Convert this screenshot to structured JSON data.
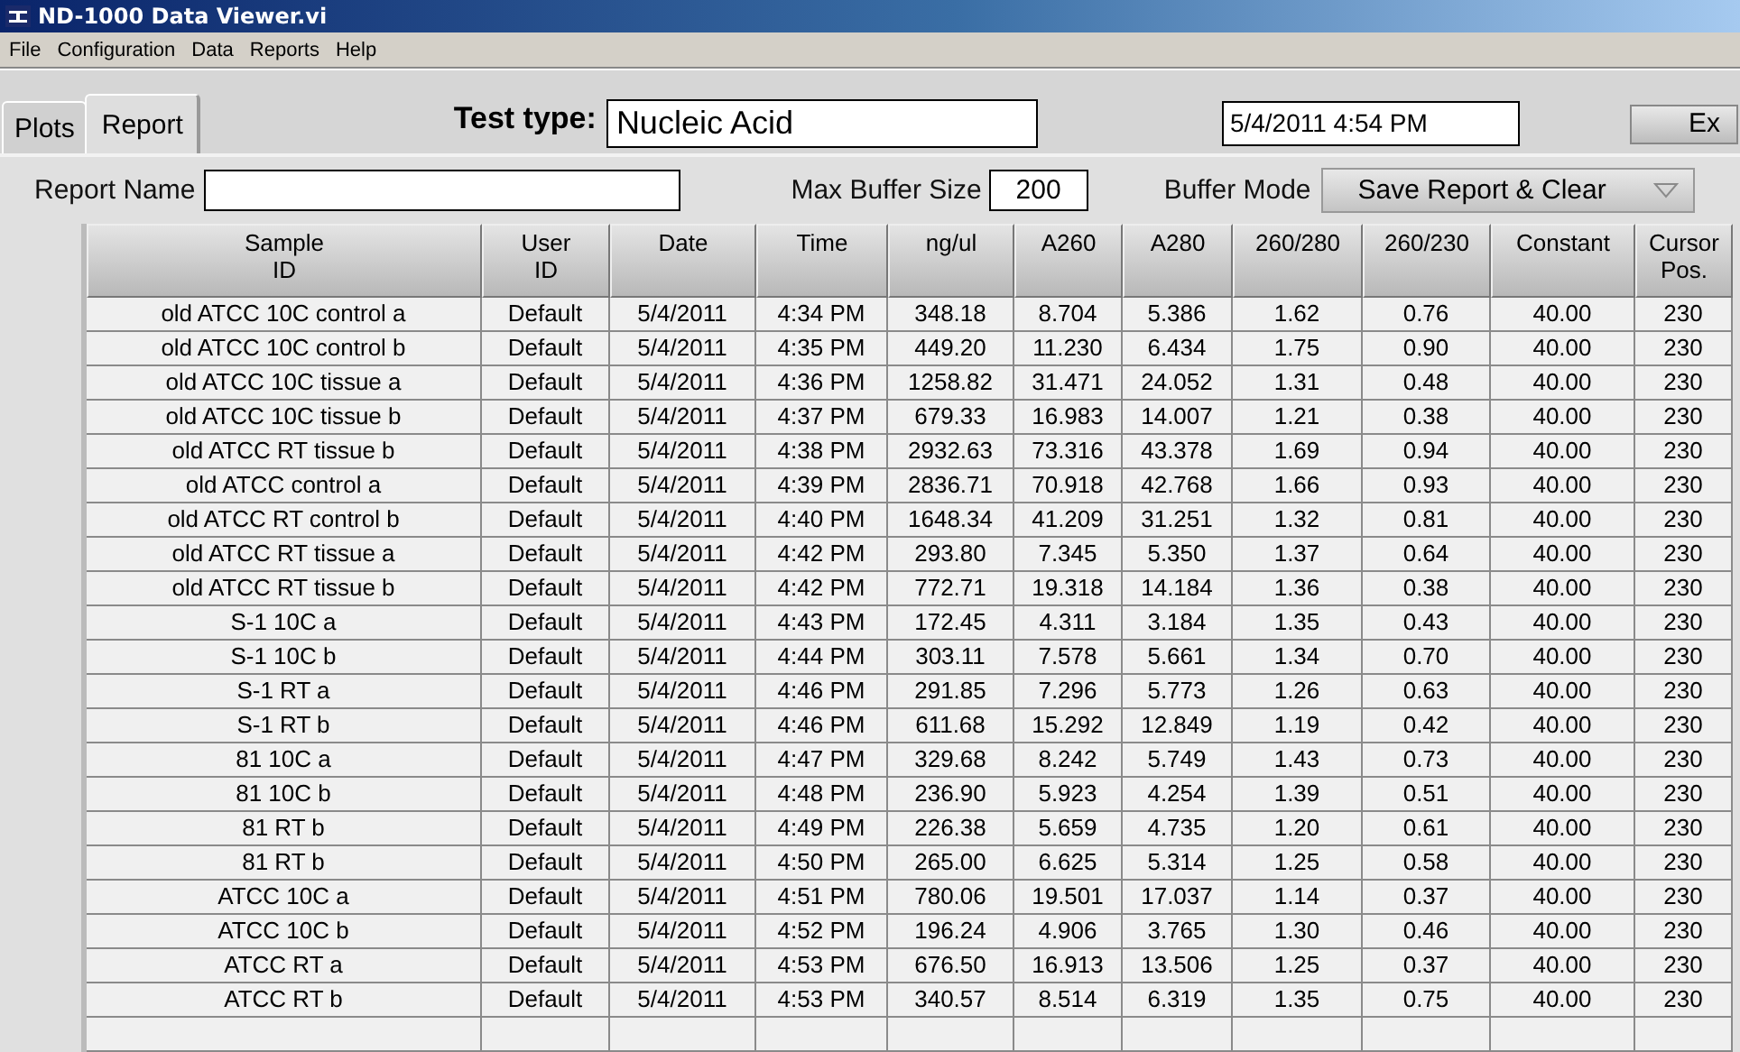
{
  "window": {
    "title": "ND-1000 Data Viewer.vi"
  },
  "menu": [
    "File",
    "Configuration",
    "Data",
    "Reports",
    "Help"
  ],
  "tabs": [
    {
      "label": "Plots",
      "selected": false
    },
    {
      "label": "Report",
      "selected": true
    }
  ],
  "test_type": {
    "label": "Test type:",
    "value": "Nucleic Acid"
  },
  "datetime": "5/4/2011  4:54 PM",
  "exit_button": "Ex",
  "report_name": {
    "label": "Report Name"
  },
  "max_buffer_size": {
    "label": "Max Buffer Size",
    "value": "200"
  },
  "buffer_mode": {
    "label": "Buffer Mode",
    "value": "Save Report & Clear"
  },
  "table": {
    "columns": [
      "Sample\nID",
      "User\nID",
      "Date",
      "Time",
      "ng/ul",
      "A260",
      "A280",
      "260/280",
      "260/230",
      "Constant",
      "Cursor\nPos."
    ],
    "rows": [
      [
        "old ATCC 10C control a",
        "Default",
        "5/4/2011",
        "4:34 PM",
        "348.18",
        "8.704",
        "5.386",
        "1.62",
        "0.76",
        "40.00",
        "230"
      ],
      [
        "old ATCC 10C control b",
        "Default",
        "5/4/2011",
        "4:35 PM",
        "449.20",
        "11.230",
        "6.434",
        "1.75",
        "0.90",
        "40.00",
        "230"
      ],
      [
        "old ATCC 10C tissue a",
        "Default",
        "5/4/2011",
        "4:36 PM",
        "1258.82",
        "31.471",
        "24.052",
        "1.31",
        "0.48",
        "40.00",
        "230"
      ],
      [
        "old ATCC 10C tissue b",
        "Default",
        "5/4/2011",
        "4:37 PM",
        "679.33",
        "16.983",
        "14.007",
        "1.21",
        "0.38",
        "40.00",
        "230"
      ],
      [
        "old ATCC RT tissue b",
        "Default",
        "5/4/2011",
        "4:38 PM",
        "2932.63",
        "73.316",
        "43.378",
        "1.69",
        "0.94",
        "40.00",
        "230"
      ],
      [
        "old ATCC control a",
        "Default",
        "5/4/2011",
        "4:39 PM",
        "2836.71",
        "70.918",
        "42.768",
        "1.66",
        "0.93",
        "40.00",
        "230"
      ],
      [
        "old ATCC RT control b",
        "Default",
        "5/4/2011",
        "4:40 PM",
        "1648.34",
        "41.209",
        "31.251",
        "1.32",
        "0.81",
        "40.00",
        "230"
      ],
      [
        "old ATCC RT tissue a",
        "Default",
        "5/4/2011",
        "4:42 PM",
        "293.80",
        "7.345",
        "5.350",
        "1.37",
        "0.64",
        "40.00",
        "230"
      ],
      [
        "old ATCC RT tissue b",
        "Default",
        "5/4/2011",
        "4:42 PM",
        "772.71",
        "19.318",
        "14.184",
        "1.36",
        "0.38",
        "40.00",
        "230"
      ],
      [
        "S-1 10C a",
        "Default",
        "5/4/2011",
        "4:43 PM",
        "172.45",
        "4.311",
        "3.184",
        "1.35",
        "0.43",
        "40.00",
        "230"
      ],
      [
        "S-1 10C b",
        "Default",
        "5/4/2011",
        "4:44 PM",
        "303.11",
        "7.578",
        "5.661",
        "1.34",
        "0.70",
        "40.00",
        "230"
      ],
      [
        "S-1 RT a",
        "Default",
        "5/4/2011",
        "4:46 PM",
        "291.85",
        "7.296",
        "5.773",
        "1.26",
        "0.63",
        "40.00",
        "230"
      ],
      [
        "S-1 RT b",
        "Default",
        "5/4/2011",
        "4:46 PM",
        "611.68",
        "15.292",
        "12.849",
        "1.19",
        "0.42",
        "40.00",
        "230"
      ],
      [
        "81 10C a",
        "Default",
        "5/4/2011",
        "4:47 PM",
        "329.68",
        "8.242",
        "5.749",
        "1.43",
        "0.73",
        "40.00",
        "230"
      ],
      [
        "81 10C b",
        "Default",
        "5/4/2011",
        "4:48 PM",
        "236.90",
        "5.923",
        "4.254",
        "1.39",
        "0.51",
        "40.00",
        "230"
      ],
      [
        "81 RT b",
        "Default",
        "5/4/2011",
        "4:49 PM",
        "226.38",
        "5.659",
        "4.735",
        "1.20",
        "0.61",
        "40.00",
        "230"
      ],
      [
        "81 RT b",
        "Default",
        "5/4/2011",
        "4:50 PM",
        "265.00",
        "6.625",
        "5.314",
        "1.25",
        "0.58",
        "40.00",
        "230"
      ],
      [
        "ATCC 10C a",
        "Default",
        "5/4/2011",
        "4:51 PM",
        "780.06",
        "19.501",
        "17.037",
        "1.14",
        "0.37",
        "40.00",
        "230"
      ],
      [
        "ATCC 10C b",
        "Default",
        "5/4/2011",
        "4:52 PM",
        "196.24",
        "4.906",
        "3.765",
        "1.30",
        "0.46",
        "40.00",
        "230"
      ],
      [
        "ATCC RT a",
        "Default",
        "5/4/2011",
        "4:53 PM",
        "676.50",
        "16.913",
        "13.506",
        "1.25",
        "0.37",
        "40.00",
        "230"
      ],
      [
        "ATCC RT b",
        "Default",
        "5/4/2011",
        "4:53 PM",
        "340.57",
        "8.514",
        "6.319",
        "1.35",
        "0.75",
        "40.00",
        "230"
      ]
    ]
  }
}
